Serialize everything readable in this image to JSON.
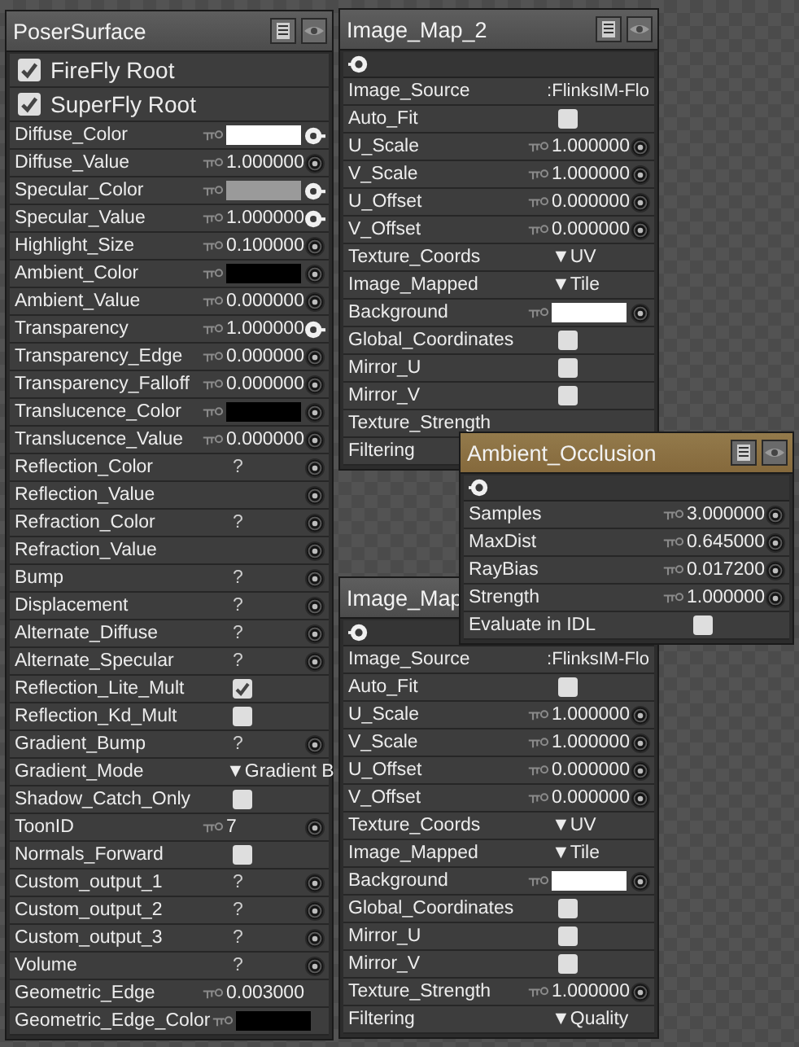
{
  "nodes": [
    {
      "title": "PoserSurface",
      "selected": false,
      "menu_icons": true,
      "output": false,
      "roots": [
        {
          "label": "FireFly Root",
          "checked": true
        },
        {
          "label": "SuperFly Root",
          "checked": true
        }
      ],
      "rows": [
        {
          "kind": "color",
          "label": "Diffuse_Color",
          "color": "#ffffff",
          "socket": true,
          "linked": true
        },
        {
          "kind": "value",
          "label": "Diffuse_Value",
          "value": "1.000000",
          "socket": true,
          "linked": false
        },
        {
          "kind": "color",
          "label": "Specular_Color",
          "color": "#9a9a9a",
          "socket": true,
          "linked": true
        },
        {
          "kind": "value",
          "label": "Specular_Value",
          "value": "1.000000",
          "socket": true,
          "linked": true
        },
        {
          "kind": "value",
          "label": "Highlight_Size",
          "value": "0.100000",
          "socket": true,
          "linked": false
        },
        {
          "kind": "color",
          "label": "Ambient_Color",
          "color": "#000000",
          "socket": true,
          "linked": false
        },
        {
          "kind": "value",
          "label": "Ambient_Value",
          "value": "0.000000",
          "socket": true,
          "linked": false
        },
        {
          "kind": "value",
          "label": "Transparency",
          "value": "1.000000",
          "socket": true,
          "linked": true
        },
        {
          "kind": "value",
          "label": "Transparency_Edge",
          "value": "0.000000",
          "socket": true,
          "linked": false
        },
        {
          "kind": "value",
          "label": "Transparency_Falloff",
          "value": "0.000000",
          "socket": true,
          "linked": false
        },
        {
          "kind": "color",
          "label": "Translucence_Color",
          "color": "#000000",
          "socket": true,
          "linked": false
        },
        {
          "kind": "value",
          "label": "Translucence_Value",
          "value": "0.000000",
          "socket": true,
          "linked": false
        },
        {
          "kind": "unknown",
          "label": "Reflection_Color",
          "value": "?",
          "socket": true,
          "linked": false
        },
        {
          "kind": "plain",
          "label": "Reflection_Value",
          "socket": true,
          "linked": false
        },
        {
          "kind": "unknown",
          "label": "Refraction_Color",
          "value": "?",
          "socket": true,
          "linked": false
        },
        {
          "kind": "plain",
          "label": "Refraction_Value",
          "socket": true,
          "linked": false
        },
        {
          "kind": "unknown",
          "label": "Bump",
          "value": "?",
          "socket": true,
          "linked": false
        },
        {
          "kind": "unknown",
          "label": "Displacement",
          "value": "?",
          "socket": true,
          "linked": false
        },
        {
          "kind": "unknown",
          "label": "Alternate_Diffuse",
          "value": "?",
          "socket": true,
          "linked": false
        },
        {
          "kind": "unknown",
          "label": "Alternate_Specular",
          "value": "?",
          "socket": true,
          "linked": false
        },
        {
          "kind": "checkbox",
          "label": "Reflection_Lite_Mult",
          "checked": true,
          "socket": false
        },
        {
          "kind": "checkbox",
          "label": "Reflection_Kd_Mult",
          "checked": false,
          "socket": false
        },
        {
          "kind": "unknown",
          "label": "Gradient_Bump",
          "value": "?",
          "socket": true,
          "linked": false
        },
        {
          "kind": "menu",
          "label": "Gradient_Mode",
          "value": "▼Gradient B",
          "socket": false
        },
        {
          "kind": "checkbox",
          "label": "Shadow_Catch_Only",
          "checked": false,
          "socket": false
        },
        {
          "kind": "value",
          "label": "ToonID",
          "value": "7",
          "socket": true,
          "linked": false
        },
        {
          "kind": "checkbox",
          "label": "Normals_Forward",
          "checked": false,
          "socket": false
        },
        {
          "kind": "unknown",
          "label": "Custom_output_1",
          "value": "?",
          "socket": true,
          "linked": false
        },
        {
          "kind": "unknown",
          "label": "Custom_output_2",
          "value": "?",
          "socket": true,
          "linked": false
        },
        {
          "kind": "unknown",
          "label": "Custom_output_3",
          "value": "?",
          "socket": true,
          "linked": false
        },
        {
          "kind": "unknown",
          "label": "Volume",
          "value": "?",
          "socket": true,
          "linked": false
        },
        {
          "kind": "value",
          "label": "Geometric_Edge",
          "value": "0.003000",
          "socket": false
        },
        {
          "kind": "color",
          "label": "Geometric_Edge_Color",
          "color": "#000000",
          "socket": false
        }
      ]
    },
    {
      "title": "Image_Map_2",
      "selected": false,
      "menu_icons": true,
      "output": true,
      "rows": [
        {
          "kind": "text",
          "label": "Image_Source",
          "value": ":FlinksIM-Flo",
          "socket": false
        },
        {
          "kind": "checkbox",
          "label": "Auto_Fit",
          "checked": false,
          "socket": false
        },
        {
          "kind": "value",
          "label": "U_Scale",
          "value": "1.000000",
          "socket": true,
          "linked": false
        },
        {
          "kind": "value",
          "label": "V_Scale",
          "value": "1.000000",
          "socket": true,
          "linked": false
        },
        {
          "kind": "value",
          "label": "U_Offset",
          "value": "0.000000",
          "socket": true,
          "linked": false
        },
        {
          "kind": "value",
          "label": "V_Offset",
          "value": "0.000000",
          "socket": true,
          "linked": false
        },
        {
          "kind": "menu",
          "label": "Texture_Coords",
          "value": "▼UV",
          "socket": false
        },
        {
          "kind": "menu",
          "label": "Image_Mapped",
          "value": "▼Tile",
          "socket": false
        },
        {
          "kind": "color",
          "label": "Background",
          "color": "#ffffff",
          "socket": true,
          "linked": false
        },
        {
          "kind": "checkbox",
          "label": "Global_Coordinates",
          "checked": false,
          "socket": false
        },
        {
          "kind": "checkbox",
          "label": "Mirror_U",
          "checked": false,
          "socket": false
        },
        {
          "kind": "checkbox",
          "label": "Mirror_V",
          "checked": false,
          "socket": false
        },
        {
          "kind": "plain",
          "label": "Texture_Strength",
          "socket": false
        },
        {
          "kind": "plain",
          "label": "Filtering",
          "socket": false
        }
      ]
    },
    {
      "title": "Image_Map",
      "selected": false,
      "menu_icons": false,
      "output": true,
      "rows": [
        {
          "kind": "text",
          "label": "Image_Source",
          "value": ":FlinksIM-Flo",
          "socket": false
        },
        {
          "kind": "checkbox",
          "label": "Auto_Fit",
          "checked": false,
          "socket": false
        },
        {
          "kind": "value",
          "label": "U_Scale",
          "value": "1.000000",
          "socket": true,
          "linked": false
        },
        {
          "kind": "value",
          "label": "V_Scale",
          "value": "1.000000",
          "socket": true,
          "linked": false
        },
        {
          "kind": "value",
          "label": "U_Offset",
          "value": "0.000000",
          "socket": true,
          "linked": false
        },
        {
          "kind": "value",
          "label": "V_Offset",
          "value": "0.000000",
          "socket": true,
          "linked": false
        },
        {
          "kind": "menu",
          "label": "Texture_Coords",
          "value": "▼UV",
          "socket": false
        },
        {
          "kind": "menu",
          "label": "Image_Mapped",
          "value": "▼Tile",
          "socket": false
        },
        {
          "kind": "color",
          "label": "Background",
          "color": "#ffffff",
          "socket": true,
          "linked": false
        },
        {
          "kind": "checkbox",
          "label": "Global_Coordinates",
          "checked": false,
          "socket": false
        },
        {
          "kind": "checkbox",
          "label": "Mirror_U",
          "checked": false,
          "socket": false
        },
        {
          "kind": "checkbox",
          "label": "Mirror_V",
          "checked": false,
          "socket": false
        },
        {
          "kind": "value",
          "label": "Texture_Strength",
          "value": "1.000000",
          "socket": true,
          "linked": false
        },
        {
          "kind": "menu",
          "label": "Filtering",
          "value": "▼Quality",
          "socket": false
        }
      ]
    },
    {
      "title": "Ambient_Occlusion",
      "selected": true,
      "menu_icons": true,
      "output": true,
      "rows": [
        {
          "kind": "value",
          "label": "Samples",
          "value": "3.000000",
          "socket": true,
          "linked": false
        },
        {
          "kind": "value",
          "label": "MaxDist",
          "value": "0.645000",
          "socket": true,
          "linked": false
        },
        {
          "kind": "value",
          "label": "RayBias",
          "value": "0.017200",
          "socket": true,
          "linked": false
        },
        {
          "kind": "value",
          "label": "Strength",
          "value": "1.000000",
          "socket": true,
          "linked": false
        },
        {
          "kind": "checkbox",
          "label": "Evaluate in IDL",
          "checked": false,
          "socket": false
        }
      ]
    }
  ]
}
